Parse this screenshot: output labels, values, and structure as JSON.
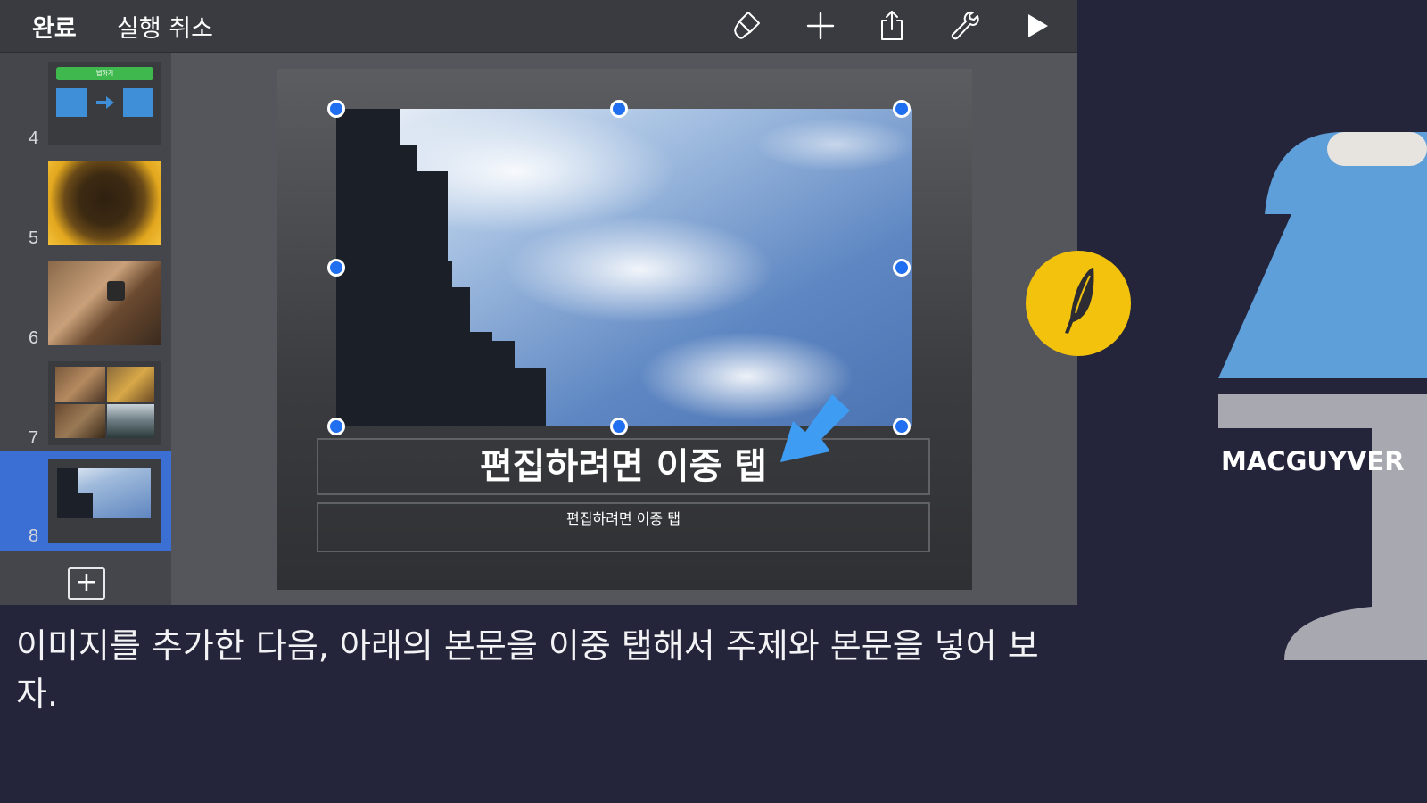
{
  "toolbar": {
    "done_label": "완료",
    "undo_label": "실행 취소",
    "icons": [
      "paintbrush-icon",
      "plus-icon",
      "share-icon",
      "wrench-icon",
      "play-icon"
    ]
  },
  "navigator": {
    "slides": [
      {
        "number": "4",
        "thumb_text": "탭하기"
      },
      {
        "number": "5"
      },
      {
        "number": "6"
      },
      {
        "number": "7"
      },
      {
        "number": "8",
        "selected": true
      }
    ],
    "add_label": "+"
  },
  "slide": {
    "title": "편집하려면 이중 탭",
    "body": "편집하려면 이중 탭"
  },
  "caption": "이미지를 추가한 다음, 아래의 본문을 이중 탭해서 주제와 본문을 넣어 보자.",
  "brand": {
    "name": "MACGUYVER"
  },
  "colors": {
    "selection": "#3b6fd4",
    "handle": "#1f6ff0",
    "arrow": "#3e9cf2",
    "badge": "#f2c20c",
    "brand_blue": "#5f9fd9"
  }
}
